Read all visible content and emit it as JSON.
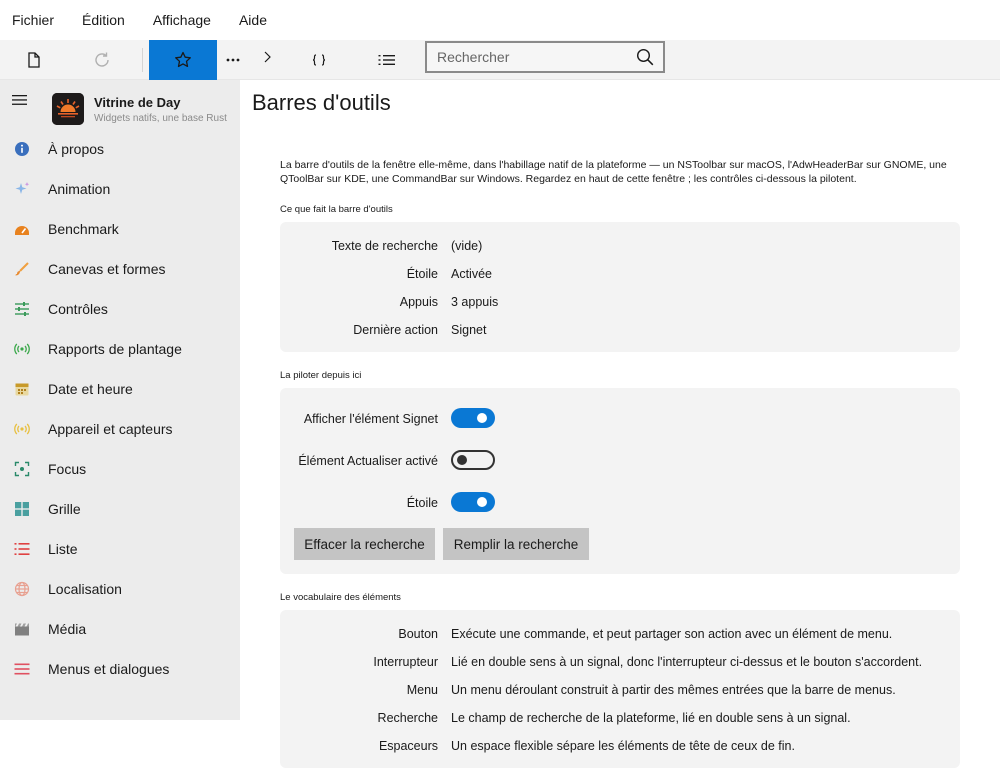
{
  "menubar": {
    "items": [
      "Fichier",
      "Édition",
      "Affichage",
      "Aide"
    ]
  },
  "toolbar": {
    "search": {
      "placeholder": "Rechercher",
      "value": ""
    },
    "active_item": "star-icon"
  },
  "sidebar": {
    "app_name": "Vitrine de Day",
    "app_subtitle": "Widgets natifs, une base Rust",
    "items": [
      {
        "label": "À propos",
        "icon": "info-icon",
        "color": "#3a6fbd"
      },
      {
        "label": "Animation",
        "icon": "sparkle-icon",
        "color": "#8ab6e8"
      },
      {
        "label": "Benchmark",
        "icon": "gauge-icon",
        "color": "#e8821e"
      },
      {
        "label": "Canevas et formes",
        "icon": "brush-icon",
        "color": "#f0a040"
      },
      {
        "label": "Contrôles",
        "icon": "sliders-icon",
        "color": "#3a9a5a"
      },
      {
        "label": "Rapports de plantage",
        "icon": "broadcast-icon",
        "color": "#3aa84a"
      },
      {
        "label": "Date et heure",
        "icon": "calendar-icon",
        "color": "#c89a2a"
      },
      {
        "label": "Appareil et capteurs",
        "icon": "sensor-icon",
        "color": "#e8c040"
      },
      {
        "label": "Focus",
        "icon": "focus-icon",
        "color": "#2a8a6a"
      },
      {
        "label": "Grille",
        "icon": "grid-icon",
        "color": "#4aa0a0"
      },
      {
        "label": "Liste",
        "icon": "list-icon",
        "color": "#e04040"
      },
      {
        "label": "Localisation",
        "icon": "globe-icon",
        "color": "#e8a090"
      },
      {
        "label": "Média",
        "icon": "clapper-icon",
        "color": "#808080"
      },
      {
        "label": "Menus et dialogues",
        "icon": "menu-icon",
        "color": "#e05060"
      }
    ]
  },
  "main": {
    "title": "Barres d'outils",
    "intro": "La barre d'outils de la fenêtre elle-même, dans l'habillage natif de la plateforme — un NSToolbar sur macOS, l'AdwHeaderBar sur GNOME, une QToolBar sur KDE, une CommandBar sur Windows. Regardez en haut de cette fenêtre ; les contrôles ci-dessous la pilotent.",
    "section_state": {
      "title": "Ce que fait la barre d'outils",
      "rows": [
        {
          "key": "Texte de recherche",
          "value": "(vide)"
        },
        {
          "key": "Étoile",
          "value": "Activée"
        },
        {
          "key": "Appuis",
          "value": "3 appuis"
        },
        {
          "key": "Dernière action",
          "value": "Signet"
        }
      ]
    },
    "section_drive": {
      "title": "La piloter depuis ici",
      "switches": [
        {
          "label": "Afficher l'élément Signet",
          "on": true
        },
        {
          "label": "Élément Actualiser activé",
          "on": false
        },
        {
          "label": "Étoile",
          "on": true
        }
      ],
      "clear_button": "Effacer la recherche",
      "fill_button": "Remplir la recherche"
    },
    "section_vocab": {
      "title": "Le vocabulaire des éléments",
      "rows": [
        {
          "key": "Bouton",
          "value": "Exécute une commande, et peut partager son action avec un élément de menu."
        },
        {
          "key": "Interrupteur",
          "value": "Lié en double sens à un signal, donc l'interrupteur ci-dessus et le bouton s'accordent."
        },
        {
          "key": "Menu",
          "value": "Un menu déroulant construit à partir des mêmes entrées que la barre de menus."
        },
        {
          "key": "Recherche",
          "value": "Le champ de recherche de la plateforme, lié en double sens à un signal."
        },
        {
          "key": "Espaceurs",
          "value": "Un espace flexible sépare les éléments de tête de ceux de fin."
        }
      ]
    }
  },
  "colors": {
    "accent": "#0a78d4",
    "sidebar_bg": "#ececec",
    "card_bg": "#f3f3f3",
    "button_bg": "#c4c4c4"
  }
}
